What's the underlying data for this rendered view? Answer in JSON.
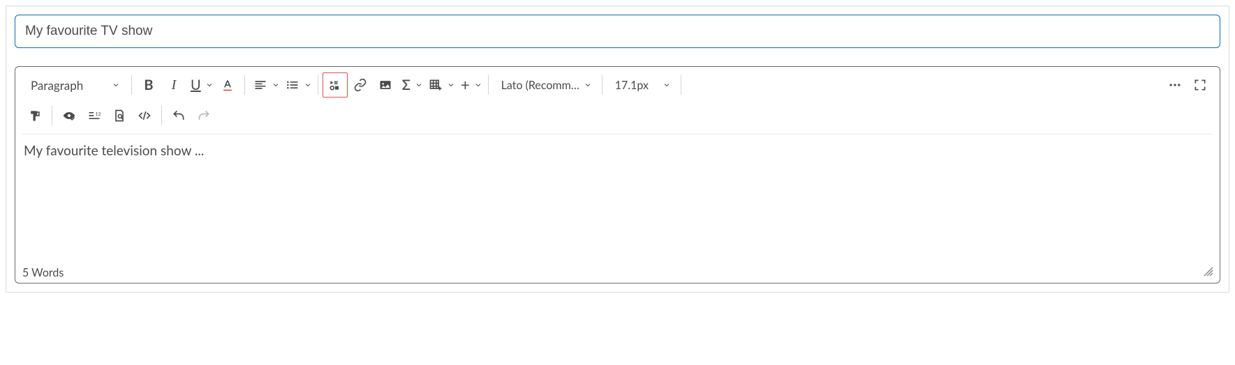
{
  "title": {
    "value": "My favourite TV show"
  },
  "toolbar": {
    "paragraph_label": "Paragraph",
    "font_label": "Lato (Recomm…",
    "size_label": "17.1px"
  },
  "content": {
    "text": "My favourite television show ..."
  },
  "footer": {
    "word_count": "5 Words"
  }
}
